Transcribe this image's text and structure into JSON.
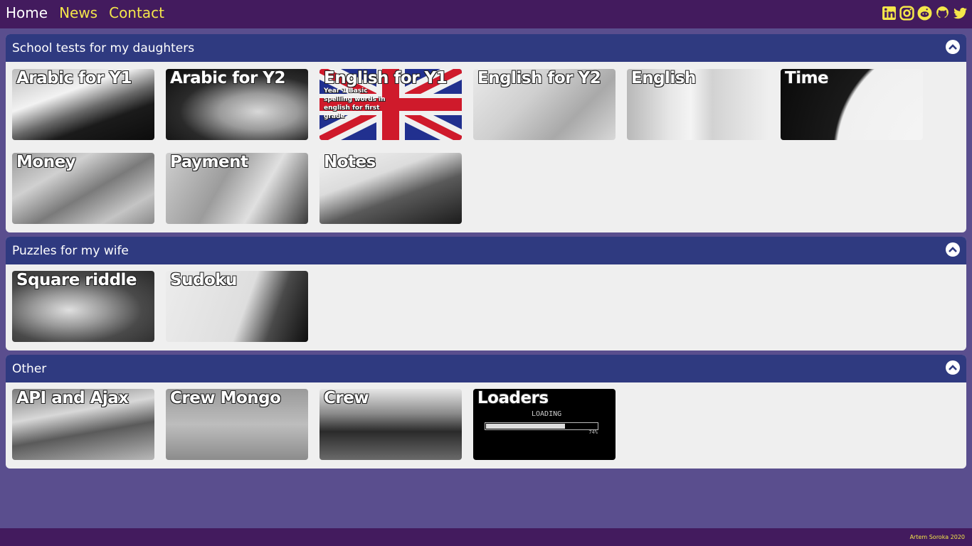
{
  "nav": {
    "home": "Home",
    "news": "News",
    "contact": "Contact"
  },
  "social": [
    "linkedin-icon",
    "instagram-icon",
    "reddit-icon",
    "github-icon",
    "twitter-icon"
  ],
  "colors": {
    "topbar": "#431b5e",
    "background": "#5a4e8e",
    "section_header": "#2f3a80",
    "accent": "#f4e64a"
  },
  "sections": [
    {
      "title": "School tests for my daughters",
      "tiles": [
        {
          "title": "Arabic for Y1"
        },
        {
          "title": "Arabic for Y2"
        },
        {
          "title": "English for Y1",
          "subtitle": "Year 1 Basic spelling words in english for first grade"
        },
        {
          "title": "English for Y2"
        },
        {
          "title": "English"
        },
        {
          "title": "Time"
        },
        {
          "title": "Money"
        },
        {
          "title": "Payment"
        },
        {
          "title": "Notes"
        }
      ]
    },
    {
      "title": "Puzzles for my wife",
      "tiles": [
        {
          "title": "Square riddle"
        },
        {
          "title": "Sudoku"
        }
      ]
    },
    {
      "title": "Other",
      "tiles": [
        {
          "title": "API and Ajax"
        },
        {
          "title": "Crew Mongo"
        },
        {
          "title": "Crew"
        },
        {
          "title": "Loaders",
          "loader_text": "LOADING",
          "loader_percent": "74%",
          "loader_progress": 0.72
        }
      ]
    }
  ],
  "footer": {
    "text": "Artem Soroka 2020"
  }
}
